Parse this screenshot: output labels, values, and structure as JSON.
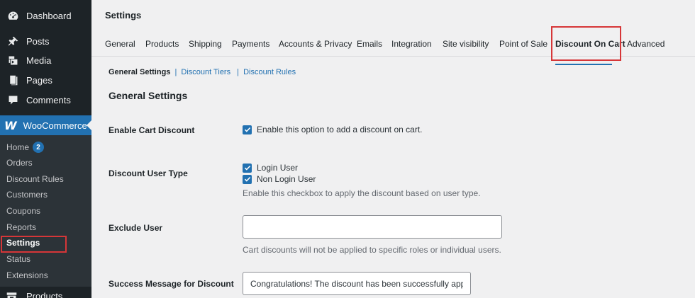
{
  "sidebar": {
    "items": [
      {
        "label": "Dashboard",
        "icon": "dashboard-icon"
      },
      {
        "label": "Posts",
        "icon": "pin-icon"
      },
      {
        "label": "Media",
        "icon": "media-icon"
      },
      {
        "label": "Pages",
        "icon": "pages-icon"
      },
      {
        "label": "Comments",
        "icon": "comments-icon"
      }
    ],
    "woocommerce": {
      "label": "WooCommerce",
      "icon": "woocommerce-icon"
    },
    "submenu": [
      {
        "label": "Home",
        "badge": "2"
      },
      {
        "label": "Orders"
      },
      {
        "label": "Discount Rules"
      },
      {
        "label": "Customers"
      },
      {
        "label": "Coupons"
      },
      {
        "label": "Reports"
      },
      {
        "label": "Settings"
      },
      {
        "label": "Status"
      },
      {
        "label": "Extensions"
      }
    ],
    "products": {
      "label": "Products",
      "icon": "products-icon"
    }
  },
  "header": {
    "title": "Settings"
  },
  "tabs": [
    "General",
    "Products",
    "Shipping",
    "Payments",
    "Accounts & Privacy",
    "Emails",
    "Integration",
    "Site visibility",
    "Point of Sale",
    "Discount On Cart",
    "Advanced"
  ],
  "subnav": {
    "current": "General Settings",
    "sep": "|",
    "links": [
      "Discount Tiers",
      "Discount Rules"
    ]
  },
  "section": {
    "title": "General Settings"
  },
  "form": {
    "enable_cart_discount": {
      "label": "Enable Cart Discount",
      "checkbox_label": "Enable this option to add a discount on cart.",
      "checked": true
    },
    "discount_user_type": {
      "label": "Discount User Type",
      "options": [
        {
          "label": "Login User",
          "checked": true
        },
        {
          "label": "Non Login User",
          "checked": true
        }
      ],
      "description": "Enable this checkbox to apply the discount based on user type."
    },
    "exclude_user": {
      "label": "Exclude User",
      "value": "",
      "description": "Cart discounts will not be applied to specific roles or individual users."
    },
    "success_message": {
      "label": "Success Message for Discount",
      "value": "Congratulations! The discount has been successfully applied"
    }
  },
  "colors": {
    "accent": "#2271b1",
    "highlight": "#d63638",
    "sidebar": "#1d2327"
  }
}
